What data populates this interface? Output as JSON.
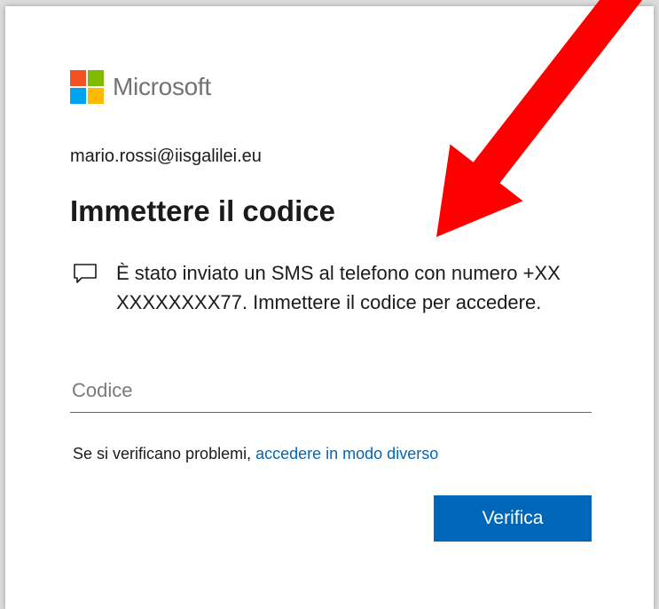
{
  "brand": {
    "name": "Microsoft",
    "logo_colors": [
      "#f25022",
      "#7fba00",
      "#00a4ef",
      "#ffb900"
    ]
  },
  "account": {
    "email": "mario.rossi@iisgalilei.eu"
  },
  "page": {
    "title": "Immettere il codice",
    "message": "È stato inviato un SMS al telefono con numero +XX XXXXXXXX77. Immettere il codice per accedere.",
    "message_icon": "chat-bubble-icon"
  },
  "code_field": {
    "placeholder": "Codice",
    "value": ""
  },
  "help": {
    "prefix": "Se si verificano problemi, ",
    "link": "accedere in modo diverso"
  },
  "actions": {
    "verify_label": "Verifica"
  },
  "colors": {
    "accent": "#0067b8",
    "annotation_arrow": "#ff0000"
  }
}
